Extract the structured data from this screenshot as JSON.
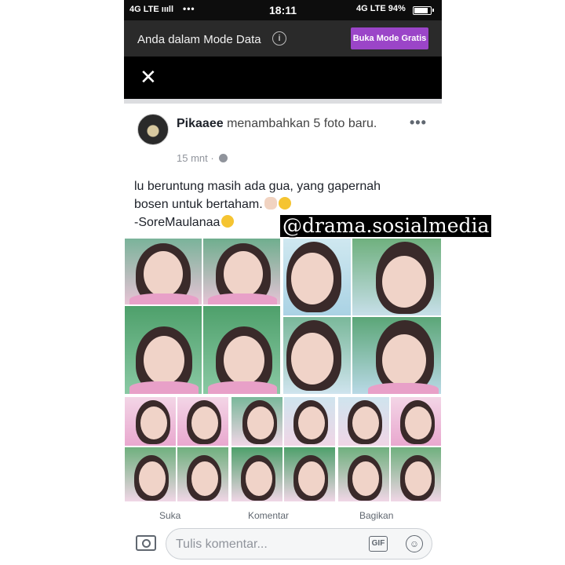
{
  "status_bar": {
    "network_left": "4G LTE",
    "signal": "ıııll",
    "dots": "•••",
    "time": "18:11",
    "network_right": "4G LTE",
    "battery": "94%"
  },
  "data_mode": {
    "text": "Anda dalam Mode Data",
    "info_icon": "i",
    "button_label": "Buka Mode Gratis"
  },
  "close": {
    "icon": "✕"
  },
  "post": {
    "author": "Pikaaee",
    "action": "menambahkan 5 foto baru.",
    "time": "15 mnt",
    "separator": "·",
    "more_icon": "•••",
    "text_line1": "lu beruntung masih ada gua, yang gapernah",
    "text_line2": "bosen untuk bertaham.",
    "text_line3": "-SoreMaulanaa"
  },
  "reactions": {
    "like": "Suka",
    "comment": "Komentar",
    "share": "Bagikan"
  },
  "comment_bar": {
    "placeholder": "Tulis komentar...",
    "gif": "GIF",
    "smile": "☺"
  },
  "watermark": "@drama.sosialmedia",
  "colors": {
    "status_bar_bg": "#0d0d0d",
    "data_bar_bg": "#2a2a2a",
    "free_button": "#9b45c8",
    "close_bar_bg": "#000000"
  }
}
